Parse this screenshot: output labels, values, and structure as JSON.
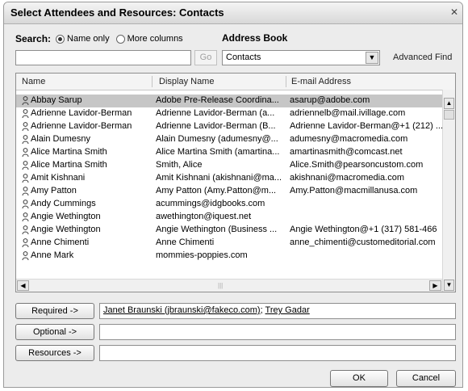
{
  "window": {
    "title": "Select Attendees and Resources: Contacts",
    "close_glyph": "✕"
  },
  "search": {
    "label": "Search:",
    "option_name_only": "Name only",
    "option_more_columns": "More columns",
    "selected": "name-only",
    "placeholder": "",
    "value": "",
    "go_label": "Go"
  },
  "address_book": {
    "label": "Address Book",
    "value": "Contacts",
    "advanced_find": "Advanced Find"
  },
  "list": {
    "columns": [
      "Name",
      "Display Name",
      "E-mail Address"
    ],
    "rows": [
      {
        "name": "Abbay Sarup",
        "display": "Adobe Pre-Release Coordina...",
        "email": "asarup@adobe.com",
        "selected": true
      },
      {
        "name": "Adrienne Lavidor-Berman",
        "display": "Adrienne Lavidor-Berman (a...",
        "email": "adriennelb@mail.ivillage.com"
      },
      {
        "name": "Adrienne Lavidor-Berman",
        "display": "Adrienne Lavidor-Berman (B...",
        "email": "Adrienne Lavidor-Berman@+1 (212) ..."
      },
      {
        "name": "Alain Dumesny",
        "display": "Alain Dumesny (adumesny@...",
        "email": "adumesny@macromedia.com"
      },
      {
        "name": "Alice Martina Smith",
        "display": "Alice Martina Smith (amartina...",
        "email": "amartinasmith@comcast.net"
      },
      {
        "name": "Alice Martina Smith",
        "display": "Smith, Alice",
        "email": "Alice.Smith@pearsoncustom.com"
      },
      {
        "name": "Amit Kishnani",
        "display": "Amit Kishnani (akishnani@ma...",
        "email": "akishnani@macromedia.com"
      },
      {
        "name": "Amy Patton",
        "display": "Amy Patton (Amy.Patton@m...",
        "email": "Amy.Patton@macmillanusa.com"
      },
      {
        "name": "Andy Cummings",
        "display": "acummings@idgbooks.com",
        "email": ""
      },
      {
        "name": "Angie Wethington",
        "display": "awethington@iquest.net",
        "email": ""
      },
      {
        "name": "Angie Wethington",
        "display": "Angie Wethington (Business ...",
        "email": "Angie Wethington@+1 (317) 581-466"
      },
      {
        "name": "Anne Chimenti",
        "display": "Anne Chimenti",
        "email": "anne_chimenti@customeditorial.com"
      },
      {
        "name": "Anne Mark",
        "display": "mommies-poppies.com",
        "email": ""
      }
    ],
    "icon": "person-contact-icon"
  },
  "roles": {
    "required_label": "Required ->",
    "required_attendees": [
      "Janet Braunski (jbraunski@fakeco.com)",
      "Trey Gadar"
    ],
    "separator": "; ",
    "optional_label": "Optional ->",
    "optional_value": "",
    "resources_label": "Resources ->",
    "resources_value": ""
  },
  "footer": {
    "ok_label": "OK",
    "cancel_label": "Cancel"
  }
}
